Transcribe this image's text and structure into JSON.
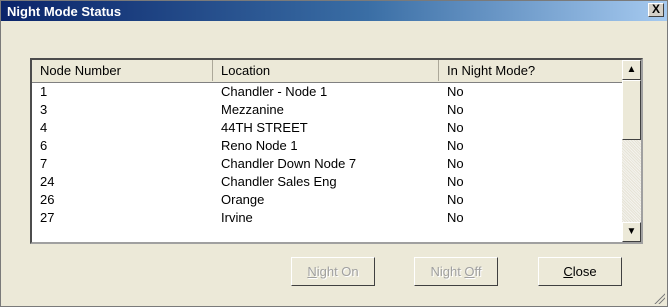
{
  "window": {
    "title": "Night Mode Status",
    "close_glyph": "X"
  },
  "list": {
    "columns": [
      "Node Number",
      "Location",
      "In Night Mode?"
    ],
    "rows": [
      {
        "node": "1",
        "location": "Chandler - Node 1",
        "night": "No"
      },
      {
        "node": "3",
        "location": "Mezzanine",
        "night": "No"
      },
      {
        "node": "4",
        "location": "44TH STREET",
        "night": "No"
      },
      {
        "node": "6",
        "location": "Reno Node 1",
        "night": "No"
      },
      {
        "node": "7",
        "location": "Chandler Down Node 7",
        "night": "No"
      },
      {
        "node": "24",
        "location": "Chandler Sales Eng",
        "night": "No"
      },
      {
        "node": "26",
        "location": "Orange",
        "night": "No"
      },
      {
        "node": "27",
        "location": "Irvine",
        "night": "No"
      }
    ],
    "scroll_up_glyph": "▲",
    "scroll_down_glyph": "▼"
  },
  "buttons": {
    "night_on": {
      "mnemonic": "N",
      "rest": "ight On",
      "enabled": false
    },
    "night_off": {
      "pre": "Night ",
      "mnemonic": "O",
      "rest": "ff",
      "enabled": false
    },
    "close": {
      "mnemonic": "C",
      "rest": "lose",
      "enabled": true
    }
  }
}
